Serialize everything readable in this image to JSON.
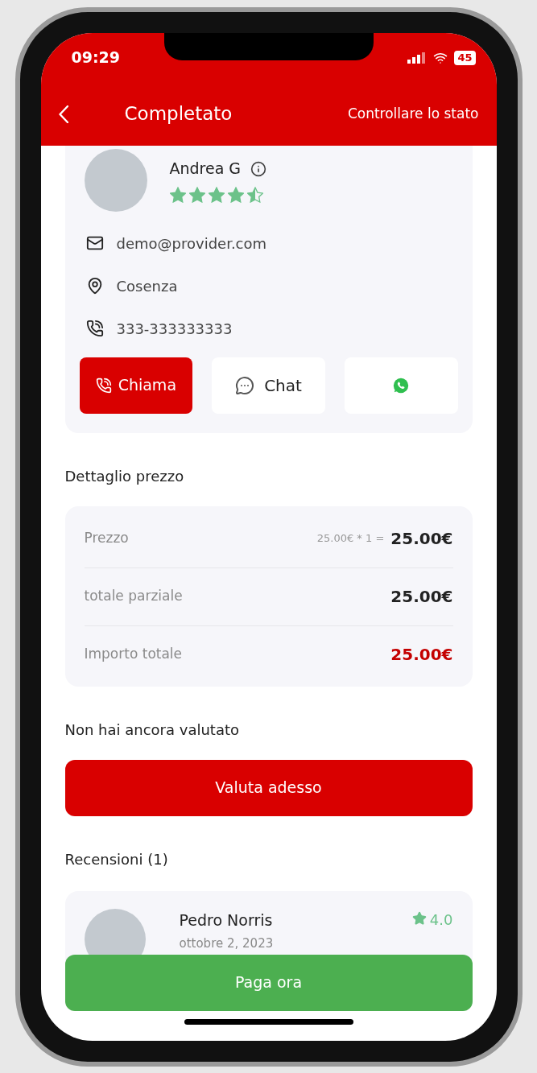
{
  "status_bar": {
    "time": "09:29",
    "battery": "45"
  },
  "header": {
    "title": "Completato",
    "action": "Controllare lo stato"
  },
  "provider": {
    "name": "Andrea G",
    "stars": 4.5,
    "contacts": [
      {
        "kind": "email",
        "text": "demo@provider.com"
      },
      {
        "kind": "location",
        "text": "Cosenza"
      },
      {
        "kind": "phone",
        "text": "333-333333333"
      }
    ],
    "actions": [
      {
        "kind": "call",
        "label": "Chiama"
      },
      {
        "kind": "chat",
        "label": "Chat"
      },
      {
        "kind": "whatsapp"
      }
    ]
  },
  "price_section": {
    "title": "Dettaglio prezzo",
    "rows": [
      {
        "label": "Prezzo",
        "formula": "25.00€ * 1 =",
        "value": "25.00€",
        "highlight": false
      },
      {
        "label": "totale parziale",
        "value": "25.00€",
        "highlight": false
      },
      {
        "label": "Importo totale",
        "value": "25.00€",
        "highlight": true
      }
    ]
  },
  "rating_prompt": {
    "text": "Non hai ancora valutato",
    "button": "Valuta adesso"
  },
  "reviews": {
    "title": "Recensioni (1)",
    "items": [
      {
        "name": "Pedro Norris",
        "date": "ottobre 2, 2023",
        "rating": "4.0"
      }
    ]
  },
  "pay_button": "Paga ora"
}
